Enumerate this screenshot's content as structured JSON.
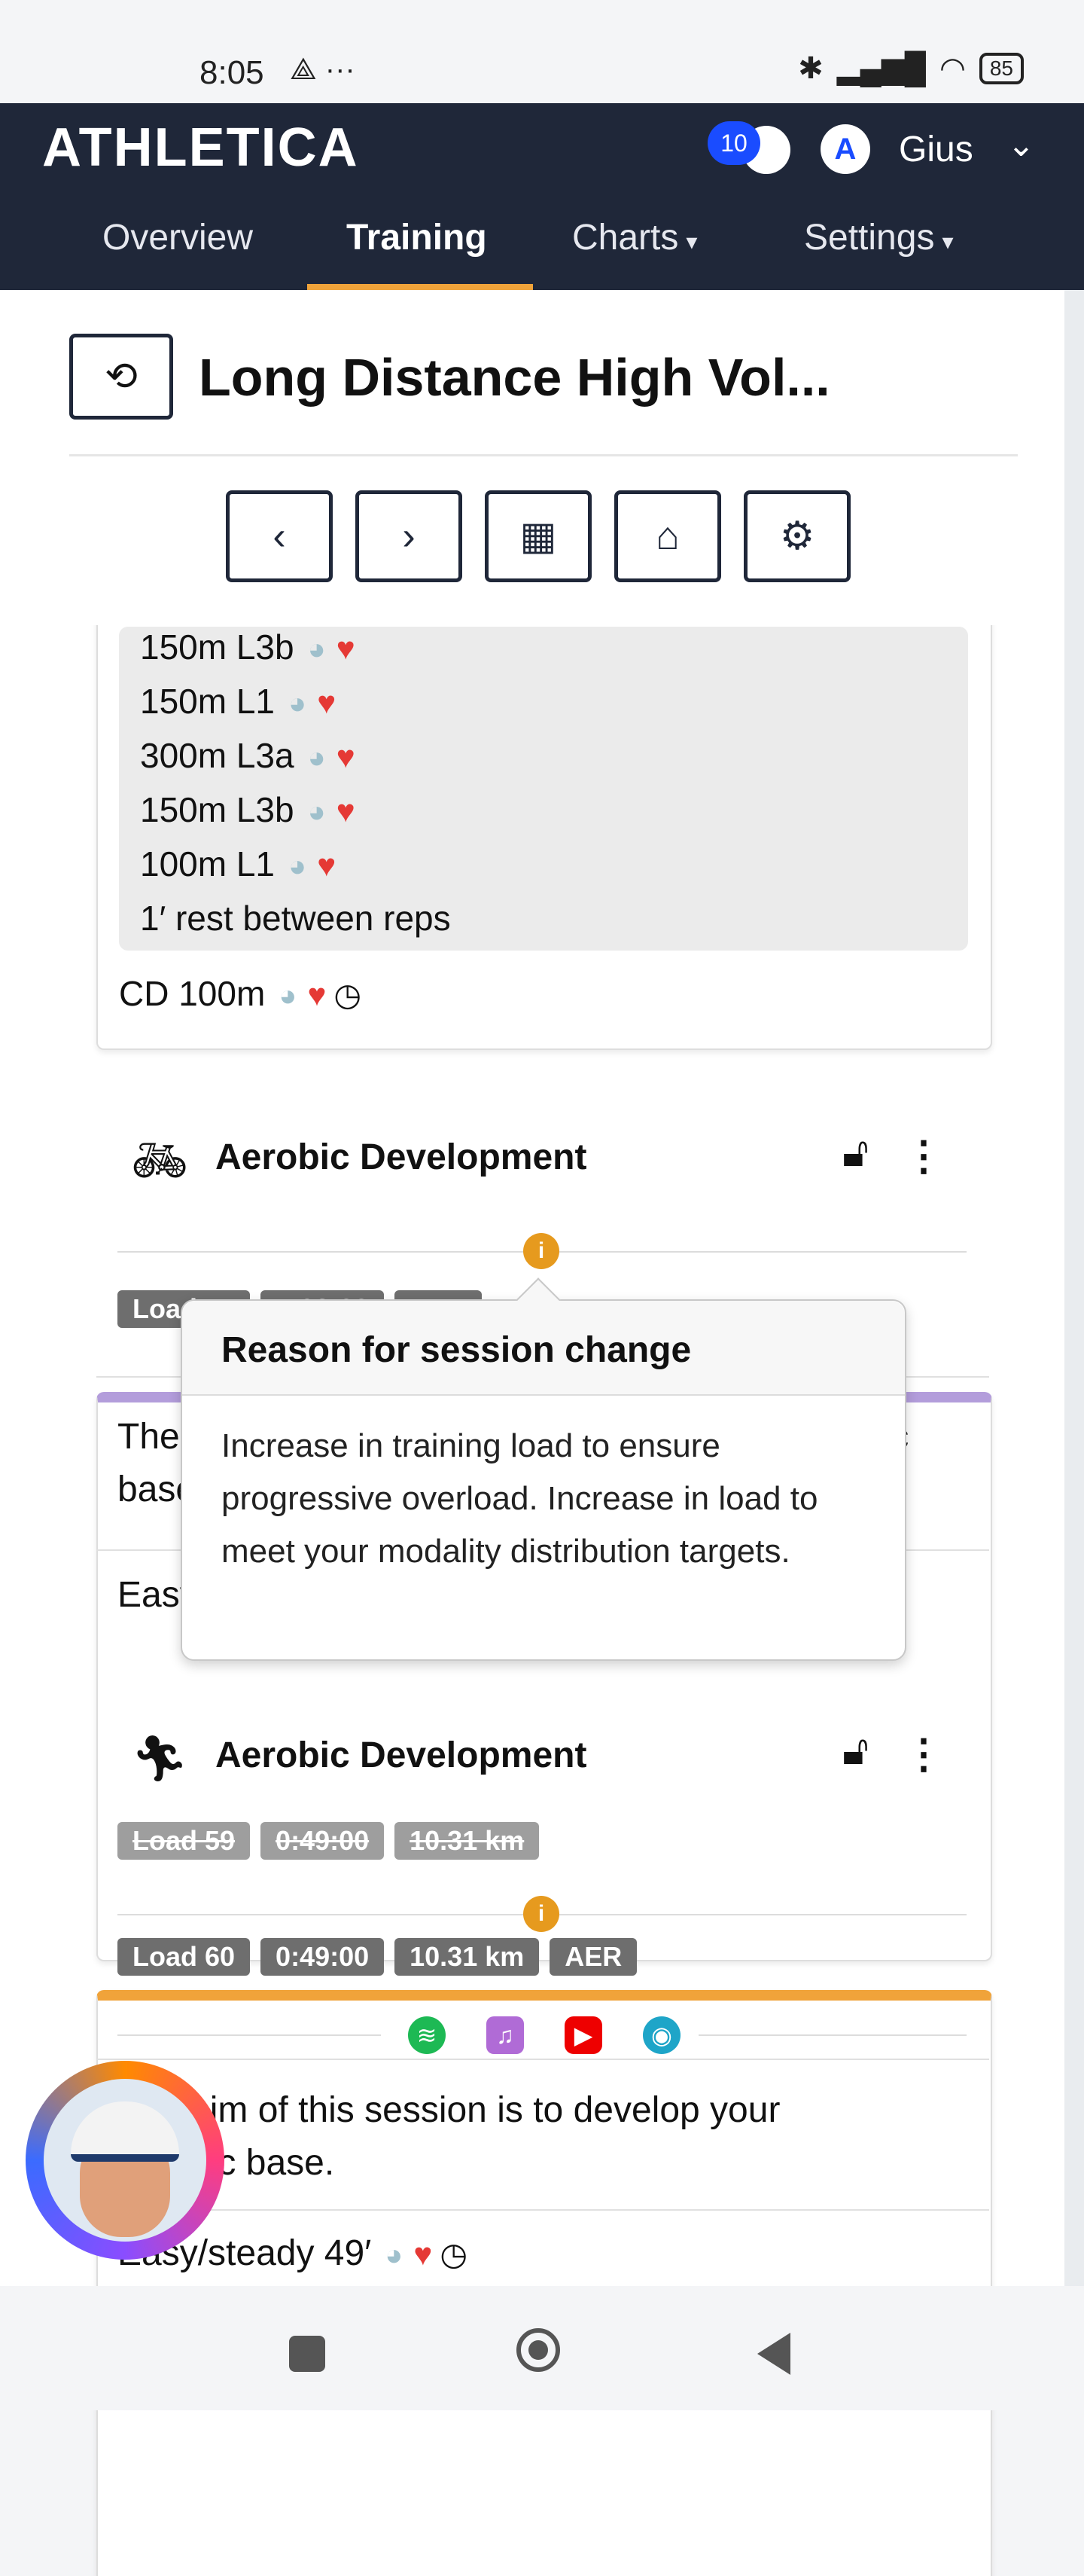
{
  "status_bar": {
    "time": "8:05",
    "left_icons": "⟁ ···",
    "battery": "85"
  },
  "navbar": {
    "logo": "ATHLETICA",
    "notification_count": "10",
    "user_name": "Gius",
    "tabs": [
      {
        "label": "Overview",
        "caret": ""
      },
      {
        "label": "Training",
        "caret": ""
      },
      {
        "label": "Charts",
        "caret": "▾"
      },
      {
        "label": "Settings",
        "caret": "▾"
      }
    ]
  },
  "page": {
    "title": "Long Distance High Vol..."
  },
  "card1": {
    "steps": [
      "150m L3b",
      "150m L1",
      "300m L3a",
      "150m L3b",
      "100m L1",
      "1′ rest between reps"
    ],
    "cooldown": "CD 100m"
  },
  "card2": {
    "title": "Aerobic Development",
    "badge_load": "Load 57",
    "badge_time": "1:03:00",
    "badge_type": "AER",
    "desc": "The aim of this session is to develop your aerobic base.",
    "detail": "Easy/steady 63′"
  },
  "popover": {
    "title": "Reason for session change",
    "body": "Increase in training load to ensure progressive overload. Increase in load to meet your modality distribution targets."
  },
  "card3": {
    "title": "Aerobic Development",
    "old_badges": [
      "Load 59",
      "0:49:00",
      "10.31 km"
    ],
    "new_badges": [
      "Load 60",
      "0:49:00",
      "10.31 km",
      "AER"
    ],
    "desc_line1": "The aim of this session is to develop your",
    "desc_line2": "aerobic base.",
    "detail": "Easy/steady 49′"
  },
  "colors": {
    "navbar": "#1f2739",
    "accent": "#f0a33a",
    "card2_top": "#b39ddb",
    "card3_top": "#f0a33a",
    "info": "#e69a1e"
  }
}
